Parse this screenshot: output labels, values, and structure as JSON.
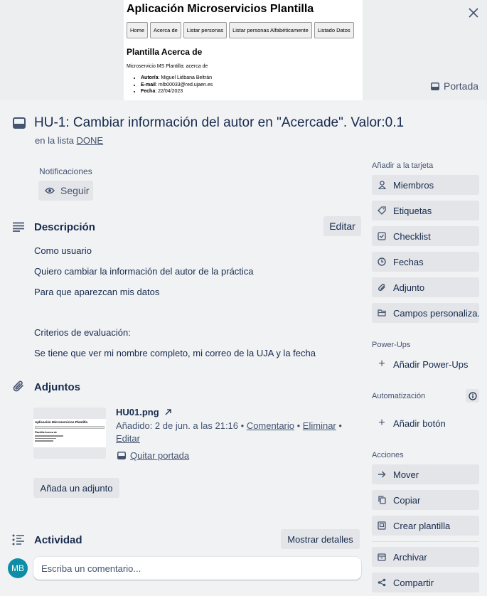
{
  "cover": {
    "app_title": "Aplicación Microservicios Plantilla",
    "nav": [
      "Home",
      "Acerca de",
      "Listar personas",
      "Listar personas Alfabéticamente",
      "Listado Datos"
    ],
    "heading": "Plantilla Acerca de",
    "subtitle": "Microservicio MS Plantilla: acerca de",
    "fields": [
      {
        "label": "Autor/a",
        "value": "Miguel Liébana Beltrán"
      },
      {
        "label": "E-mail",
        "value": "mlb00033@red.ujaen.es"
      },
      {
        "label": "Fecha",
        "value": "22/04/2023"
      }
    ],
    "cover_button": "Portada"
  },
  "card": {
    "title": "HU-1: Cambiar información del autor en \"Acercade\". Valor:0.1",
    "list_prefix": "en la lista",
    "list_name": "DONE"
  },
  "notifications": {
    "label": "Notificaciones",
    "follow": "Seguir"
  },
  "description": {
    "title": "Descripción",
    "edit": "Editar",
    "lines": [
      "Como usuario",
      "Quiero cambiar la información del autor de la práctica",
      "Para que aparezcan mis datos",
      "Criterios de evaluación:",
      "Se tiene que ver mi nombre completo, mi correo de la UJA y la fecha"
    ]
  },
  "attachments": {
    "title": "Adjuntos",
    "file_name": "HU01.png",
    "added": "Añadido: 2 de jun. a las 21:16",
    "comment": "Comentario",
    "delete": "Eliminar",
    "edit": "Editar",
    "remove_cover": "Quitar portada",
    "add": "Añada un adjunto",
    "thumb_title": "Aplicación Microservicios Plantilla",
    "thumb_heading": "Plantilla Acerca de"
  },
  "activity": {
    "title": "Actividad",
    "details": "Mostrar detalles",
    "avatar": "MB",
    "comment_placeholder": "Escriba un comentario..."
  },
  "sidebar": {
    "add_label": "Añadir a la tarjeta",
    "add_items": [
      {
        "label": "Miembros",
        "icon": "person-icon"
      },
      {
        "label": "Etiquetas",
        "icon": "label-icon"
      },
      {
        "label": "Checklist",
        "icon": "checklist-icon"
      },
      {
        "label": "Fechas",
        "icon": "clock-icon"
      },
      {
        "label": "Adjunto",
        "icon": "paperclip-icon"
      },
      {
        "label": "Campos personaliza...",
        "icon": "custom-fields-icon"
      }
    ],
    "powerups_label": "Power-Ups",
    "add_powerups": "Añadir Power-Ups",
    "automation_label": "Automatización",
    "add_button": "Añadir botón",
    "actions_label": "Acciones",
    "actions": [
      {
        "label": "Mover",
        "icon": "arrow-right-icon"
      },
      {
        "label": "Copiar",
        "icon": "copy-icon"
      },
      {
        "label": "Crear plantilla",
        "icon": "template-icon"
      },
      {
        "label": "Archivar",
        "icon": "archive-icon"
      },
      {
        "label": "Compartir",
        "icon": "share-icon"
      }
    ]
  },
  "colors": {
    "background": "#f1f2f4",
    "button": "#e3e5e8",
    "text": "#172b4d",
    "subtle": "#44546f",
    "avatar": "#0c8ea6"
  }
}
